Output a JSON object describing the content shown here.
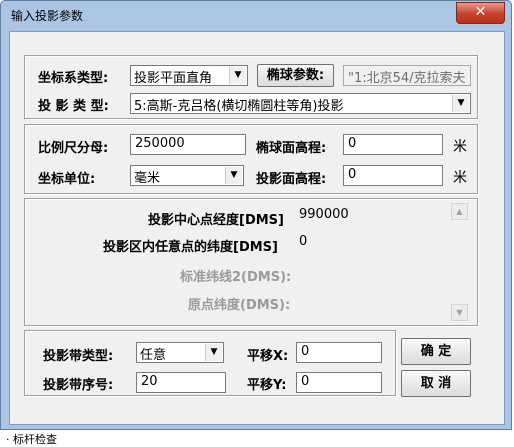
{
  "window": {
    "title": "输入投影参数",
    "close_glyph": "✕"
  },
  "group1": {
    "coord_type_label": "坐标系类型:",
    "coord_type_value": "投影平面直角",
    "ellipsoid_button": "椭球参数:",
    "ellipsoid_value": "\"1:北京54/克拉索夫",
    "proj_type_label": "投 影 类 型:",
    "proj_type_value": "5:高斯-克吕格(横切椭圆柱等角)投影"
  },
  "group2": {
    "scale_label": "比例尺分母:",
    "scale_value": "250000",
    "ellip_height_label": "椭球面高程:",
    "ellip_height_value": "0",
    "unit1": "米",
    "coord_unit_label": "坐标单位:",
    "coord_unit_value": "毫米",
    "proj_height_label": "投影面高程:",
    "proj_height_value": "0",
    "unit2": "米"
  },
  "group3": {
    "center_lon_label": "投影中心点经度[DMS]",
    "center_lon_value": "990000",
    "any_lat_label": "投影区内任意点的纬度[DMS]",
    "any_lat_value": "0",
    "std_lat2_label": "标准纬线2(DMS):",
    "origin_lat_label": "原点纬度(DMS):",
    "scroll_up": "▲",
    "scroll_down": "▼"
  },
  "group4": {
    "zone_type_label": "投影带类型:",
    "zone_type_value": "任意",
    "zone_no_label": "投影带序号:",
    "zone_no_value": "20",
    "shift_x_label": "平移X:",
    "shift_x_value": "0",
    "shift_y_label": "平移Y:",
    "shift_y_value": "0",
    "ok_button": "确  定",
    "cancel_button": "取  消"
  },
  "footer_text": "· 标杆检查"
}
